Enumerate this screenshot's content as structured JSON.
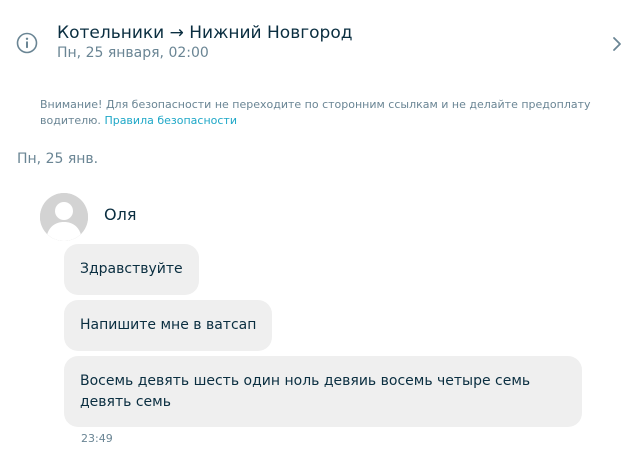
{
  "header": {
    "route": "Котельники → Нижний Новгород",
    "datetime": "Пн, 25 января, 02:00"
  },
  "warning": {
    "text": "Внимание! Для безопасности не переходите по сторонним ссылкам и не делайте предоплату водителю.",
    "link_label": "Правила безопасности"
  },
  "day_separator": "Пн, 25 янв.",
  "sender": {
    "name": "Оля",
    "avatar_icon": "user-placeholder-icon"
  },
  "messages": [
    {
      "text": "Здравствуйте"
    },
    {
      "text": "Напишите мне в ватсап"
    },
    {
      "text": "Восемь девять шесть один ноль девяиь восемь четыре семь девять семь"
    }
  ],
  "last_message_time": "23:49",
  "colors": {
    "accent": "#1ea7c7",
    "text": "#0a2e40",
    "muted": "#6a8594",
    "bubble": "#efefef"
  }
}
